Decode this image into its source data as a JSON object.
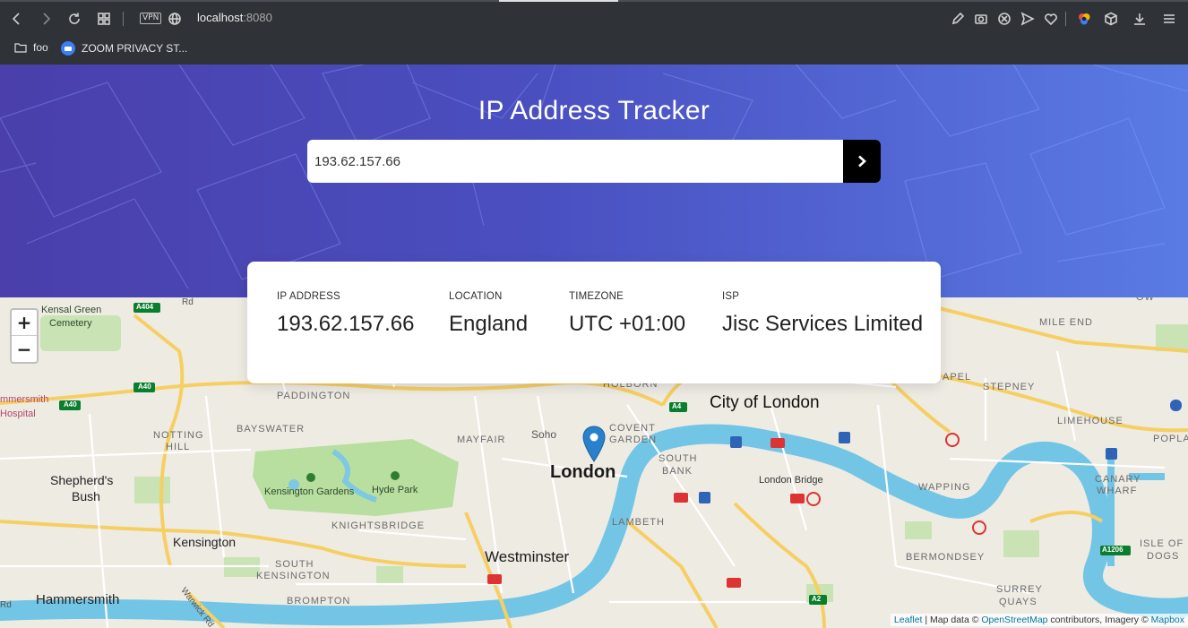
{
  "browser": {
    "url_host": "localhost",
    "url_port": ":8080",
    "vpn_label": "VPN",
    "bookmarks": [
      {
        "label": "foo",
        "icon": "folder-icon"
      },
      {
        "label": "ZOOM PRIVACY ST...",
        "icon": "zoom-icon"
      }
    ]
  },
  "hero": {
    "title": "IP Address Tracker",
    "search_value": "193.62.157.66"
  },
  "info": {
    "ip_label": "IP ADDRESS",
    "ip_value": "193.62.157.66",
    "location_label": "LOCATION",
    "location_value": "England",
    "timezone_label": "TIMEZONE",
    "timezone_value": "UTC +01:00",
    "isp_label": "ISP",
    "isp_value": "Jisc Services Limited"
  },
  "map": {
    "zoom_in": "+",
    "zoom_out": "−",
    "labels": {
      "kensal_green": "Kensal Green",
      "cemetery": "Cemetery",
      "a404": "A404",
      "a40a": "A40",
      "a40b": "A40",
      "mersmith": "mmersmith",
      "hospital": "Hospital",
      "paddington": "PADDINGTON",
      "bayswater": "BAYSWATER",
      "notting": "NOTTING",
      "hill": "HILL",
      "mayfair": "MAYFAIR",
      "soho": "Soho",
      "covent": "COVENT",
      "garden": "GARDEN",
      "holborn": "HOLBORN",
      "a4": "A4",
      "city": "City of London",
      "london": "London",
      "south": "SOUTH",
      "bank": "BANK",
      "london_bridge": "London Bridge",
      "shepherds": "Shepherd's",
      "bush": "Bush",
      "kensington_gardens": "Kensington Gardens",
      "hyde_park": "Hyde Park",
      "kensington": "Kensington",
      "knightsbridge": "KNIGHTSBRIDGE",
      "south_ken1": "SOUTH",
      "south_ken2": "KENSINGTON",
      "lambeth": "LAMBETH",
      "westminster": "Westminster",
      "hammersmith": "Hammersmith",
      "brompton": "BROMPTON",
      "warwick": "Warwick Rd",
      "mile_end": "MILE END",
      "stepney": "STEPNEY",
      "apel": "APEL",
      "limehouse": "LIMEHOUSE",
      "popla": "POPLA",
      "wapping": "WAPPING",
      "canary": "CANARY",
      "wharf": "WHARF",
      "isle": "ISLE OF",
      "dogs": "DOGS",
      "a1206": "A1206",
      "bermondsey": "BERMONDSEY",
      "surrey": "SURREY",
      "quays": "QUAYS",
      "a2": "A2",
      "ow": "OW",
      "rd": "Rd",
      "rd2": "Rd"
    },
    "attribution": {
      "leaflet": "Leaflet",
      "mid1": " | Map data © ",
      "osm": "OpenStreetMap",
      "mid2": " contributors, Imagery © ",
      "mapbox": "Mapbox"
    }
  }
}
